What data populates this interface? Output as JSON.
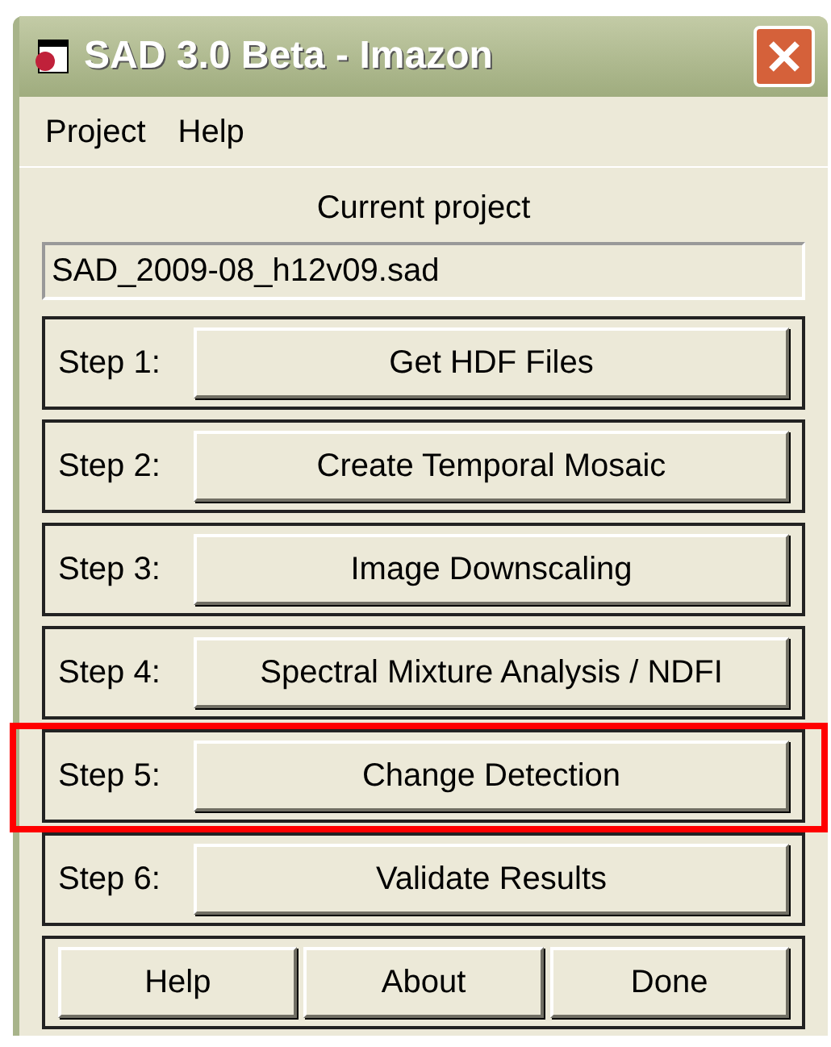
{
  "window": {
    "title": "SAD 3.0 Beta - Imazon"
  },
  "menu": [
    "Project",
    "Help"
  ],
  "project": {
    "label": "Current project",
    "value": "SAD_2009-08_h12v09.sad"
  },
  "steps": [
    {
      "label": "Step 1:",
      "button": "Get HDF Files",
      "highlighted": false
    },
    {
      "label": "Step 2:",
      "button": "Create Temporal Mosaic",
      "highlighted": false
    },
    {
      "label": "Step 3:",
      "button": "Image Downscaling",
      "highlighted": false
    },
    {
      "label": "Step 4:",
      "button": "Spectral Mixture Analysis / NDFI",
      "highlighted": false
    },
    {
      "label": "Step 5:",
      "button": "Change Detection",
      "highlighted": true
    },
    {
      "label": "Step 6:",
      "button": "Validate Results",
      "highlighted": false
    }
  ],
  "buttons": [
    "Help",
    "About",
    "Done"
  ]
}
